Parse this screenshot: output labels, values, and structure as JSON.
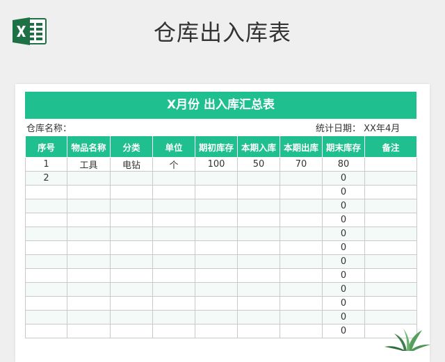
{
  "header": {
    "app_icon": "excel-icon",
    "title": "仓库出入库表"
  },
  "sheet": {
    "banner": "X月份 出入库汇总表",
    "warehouse_label": "仓库名称：",
    "date_label": "统计日期：",
    "date_value": "XX年4月",
    "columns": [
      "序号",
      "物品名称",
      "分类",
      "单位",
      "期初库存",
      "本期入库",
      "本期出库",
      "期末库存",
      "备注"
    ],
    "rows": [
      [
        "1",
        "工具",
        "电钻",
        "个",
        "100",
        "50",
        "70",
        "80",
        ""
      ],
      [
        "2",
        "",
        "",
        "",
        "",
        "",
        "",
        "0",
        ""
      ],
      [
        "",
        "",
        "",
        "",
        "",
        "",
        "",
        "0",
        ""
      ],
      [
        "",
        "",
        "",
        "",
        "",
        "",
        "",
        "0",
        ""
      ],
      [
        "",
        "",
        "",
        "",
        "",
        "",
        "",
        "0",
        ""
      ],
      [
        "",
        "",
        "",
        "",
        "",
        "",
        "",
        "0",
        ""
      ],
      [
        "",
        "",
        "",
        "",
        "",
        "",
        "",
        "0",
        ""
      ],
      [
        "",
        "",
        "",
        "",
        "",
        "",
        "",
        "0",
        ""
      ],
      [
        "",
        "",
        "",
        "",
        "",
        "",
        "",
        "0",
        ""
      ],
      [
        "",
        "",
        "",
        "",
        "",
        "",
        "",
        "0",
        ""
      ],
      [
        "",
        "",
        "",
        "",
        "",
        "",
        "",
        "0",
        ""
      ],
      [
        "",
        "",
        "",
        "",
        "",
        "",
        "",
        "0",
        ""
      ],
      [
        "",
        "",
        "",
        "",
        "",
        "",
        "",
        "0",
        ""
      ]
    ]
  },
  "colors": {
    "accent": "#20bf8f",
    "excel_green": "#1e7145",
    "page_bg": "#efefef"
  },
  "decor": {
    "plant_icon": "plant-icon"
  }
}
